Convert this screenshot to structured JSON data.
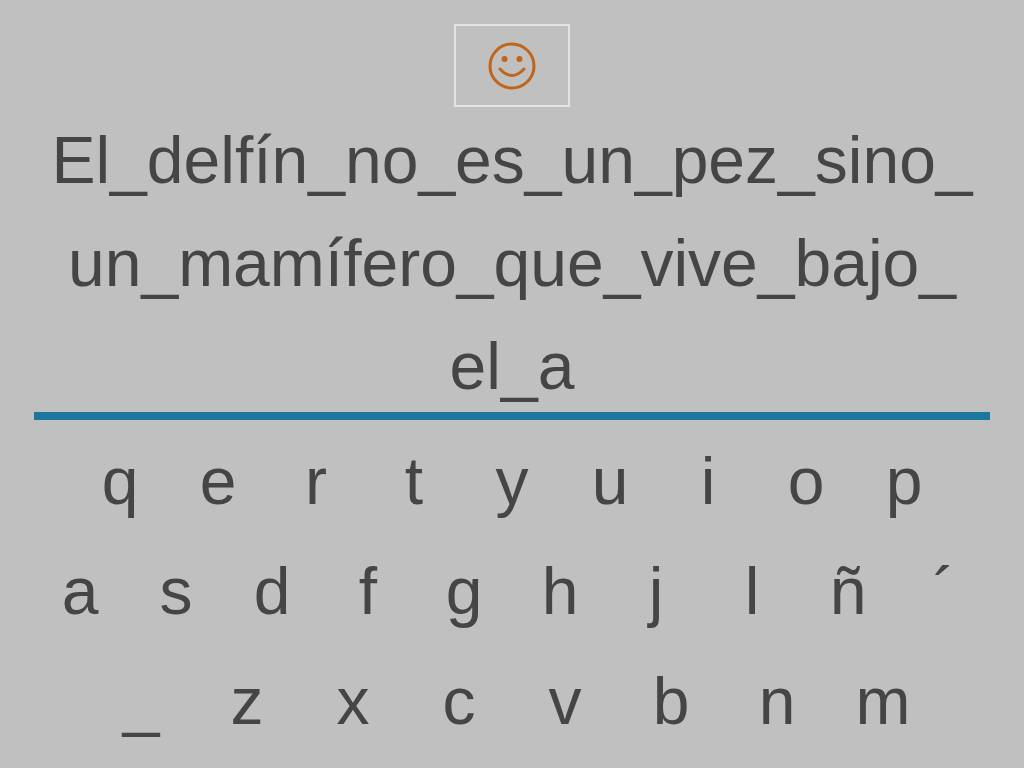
{
  "sentence_lines": [
    "El_delfín_no_es_un_pez_sino_",
    "un_mamífero_que_vive_bajo_",
    "el_a"
  ],
  "keyboard": {
    "rows": [
      [
        "q",
        "e",
        "r",
        "t",
        "y",
        "u",
        "i",
        "o",
        "p"
      ],
      [
        "a",
        "s",
        "d",
        "f",
        "g",
        "h",
        "j",
        "l",
        "ñ",
        "´"
      ],
      [
        "_",
        "z",
        "x",
        "c",
        "v",
        "b",
        "n",
        "m"
      ]
    ]
  }
}
